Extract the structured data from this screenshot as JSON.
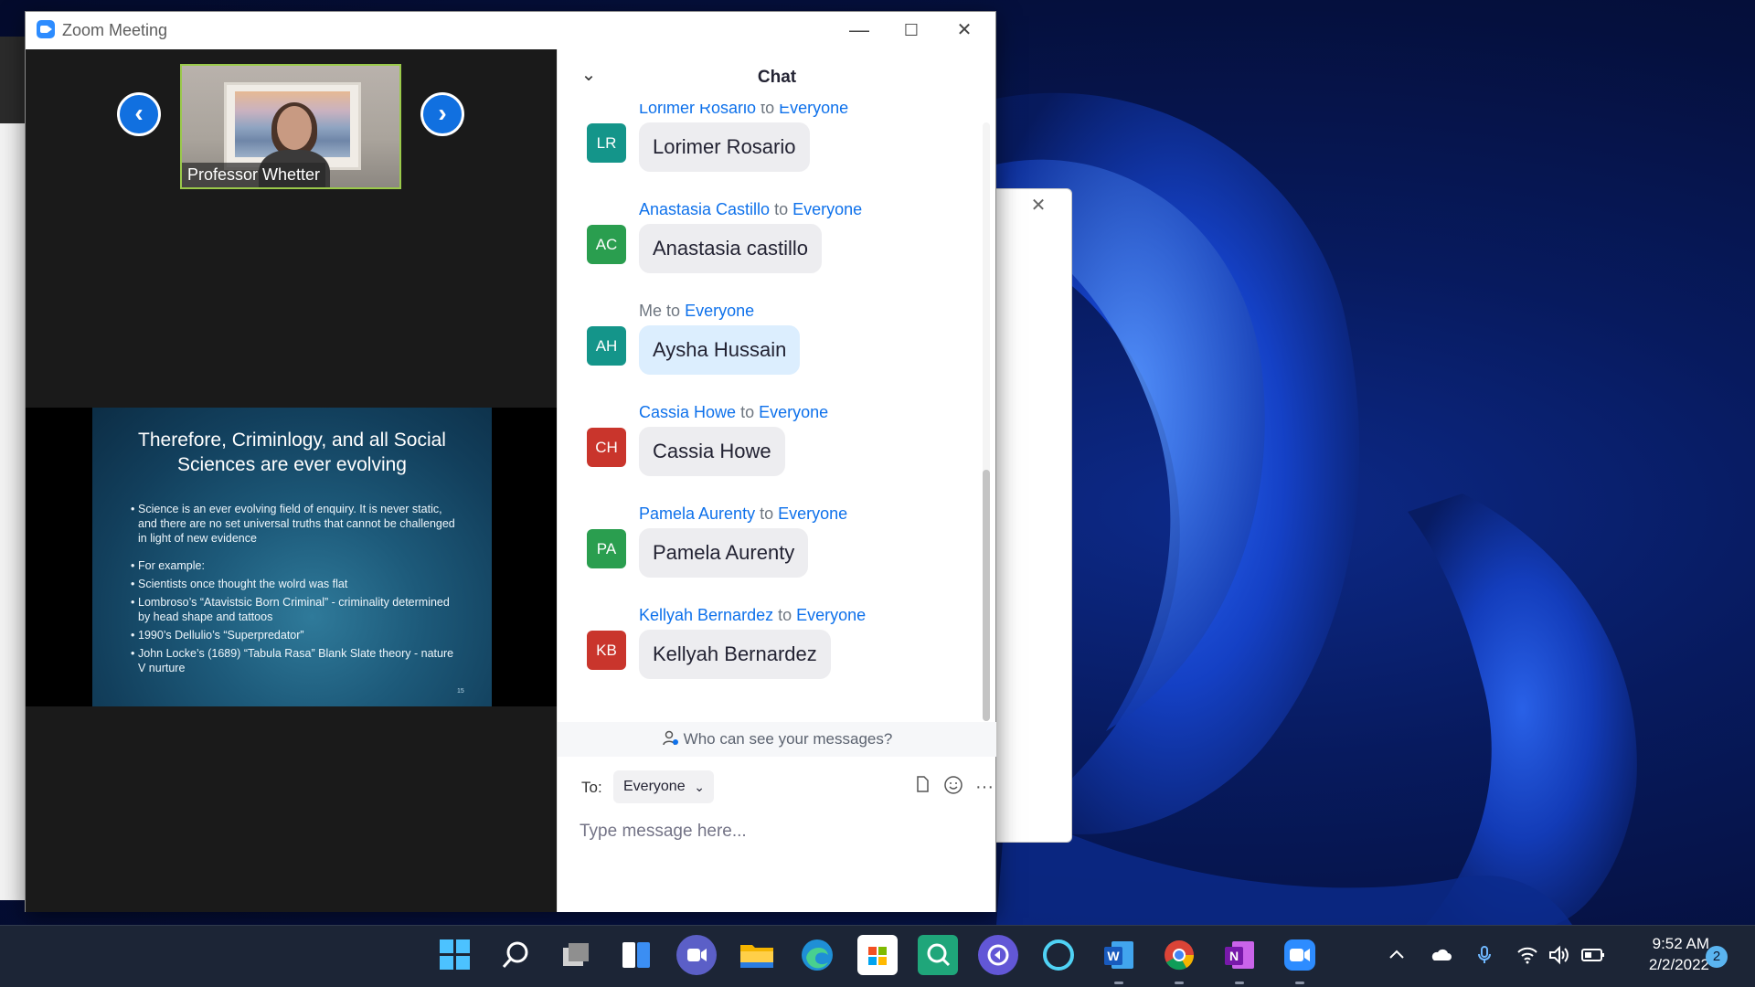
{
  "window": {
    "title": "Zoom Meeting",
    "minimize": "—",
    "maximize": "☐",
    "close": "✕"
  },
  "participant": {
    "name": "Professor Whetter"
  },
  "nav": {
    "prev": "‹",
    "next": "›"
  },
  "slide": {
    "title_line1": "Therefore, Criminlogy, and all Social",
    "title_line2": "Sciences are ever evolving",
    "bullets": [
      "Science is an ever evolving field of enquiry. It is never static, and there are no set universal truths that cannot be challenged in light of new evidence",
      "For example:",
      "Scientists once thought the wolrd was flat",
      "Lombroso’s “Atavistsic Born Criminal” - criminality determined by head shape and tattoos",
      "1990’s Dellulio’s “Superpredator”",
      "John Locke’s (1689) “Tabula Rasa” Blank Slate theory - nature V nurture"
    ],
    "page_mark": "15"
  },
  "chat": {
    "title": "Chat",
    "collapse_icon": "⌄",
    "to_word": "to",
    "messages": [
      {
        "initials": "LR",
        "color": "#14958a",
        "sender": "Lorimer Rosario",
        "recipient": "Everyone",
        "text": "Lorimer Rosario",
        "me": false
      },
      {
        "initials": "AC",
        "color": "#2a9e4f",
        "sender": "Anastasia Castillo",
        "recipient": "Everyone",
        "text": "Anastasia castillo",
        "me": false
      },
      {
        "initials": "AH",
        "color": "#14958a",
        "sender": "Me",
        "recipient": "Everyone",
        "text": "Aysha Hussain",
        "me": true
      },
      {
        "initials": "CH",
        "color": "#c9352c",
        "sender": "Cassia Howe",
        "recipient": "Everyone",
        "text": "Cassia Howe",
        "me": false
      },
      {
        "initials": "PA",
        "color": "#2a9e4f",
        "sender": "Pamela Aurenty",
        "recipient": "Everyone",
        "text": "Pamela Aurenty",
        "me": false
      },
      {
        "initials": "KB",
        "color": "#c9352c",
        "sender": "Kellyah Bernardez",
        "recipient": "Everyone",
        "text": "Kellyah Bernardez",
        "me": false
      }
    ],
    "privacy_text": "Who can see your messages?",
    "to_label": "To:",
    "to_value": "Everyone",
    "placeholder": "Type message here..."
  },
  "taskbar": {
    "icons": [
      {
        "name": "start-icon",
        "glyph": "",
        "bg": "",
        "running": false
      },
      {
        "name": "search-icon",
        "glyph": "⌕",
        "bg": "",
        "running": false
      },
      {
        "name": "task-view-icon",
        "glyph": "",
        "bg": "",
        "running": false
      },
      {
        "name": "widgets-icon",
        "glyph": "",
        "bg": "",
        "running": false
      },
      {
        "name": "teams-chat-icon",
        "glyph": "■",
        "bg": "#5b5fc7",
        "running": false
      },
      {
        "name": "file-explorer-icon",
        "glyph": "",
        "bg": "#f4b400",
        "running": false
      },
      {
        "name": "edge-icon",
        "glyph": "◐",
        "bg": "",
        "running": false
      },
      {
        "name": "store-icon",
        "glyph": "",
        "bg": "#ffffff",
        "running": false
      },
      {
        "name": "quick-assist-icon",
        "glyph": "Q",
        "bg": "#1fa67a",
        "running": false
      },
      {
        "name": "remote-icon",
        "glyph": "⟳",
        "bg": "#6257d6",
        "running": false
      },
      {
        "name": "cortana-icon",
        "glyph": "◯",
        "bg": "",
        "running": false
      },
      {
        "name": "word-icon",
        "glyph": "W",
        "bg": "#2b5fb8",
        "running": true
      },
      {
        "name": "chrome-icon",
        "glyph": "",
        "bg": "",
        "running": true
      },
      {
        "name": "onenote-icon",
        "glyph": "N",
        "bg": "#7b2fb5",
        "running": true
      },
      {
        "name": "zoom-icon",
        "glyph": "▶",
        "bg": "#2d8cff",
        "running": true
      }
    ],
    "clock_time": "9:52 AM",
    "clock_date": "2/2/2022",
    "notification_count": "2",
    "tray": {
      "chevron": "^",
      "cloud": "☁",
      "mic": "🎙",
      "wifi": "📶",
      "volume": "🔊",
      "battery": "🔋"
    }
  }
}
